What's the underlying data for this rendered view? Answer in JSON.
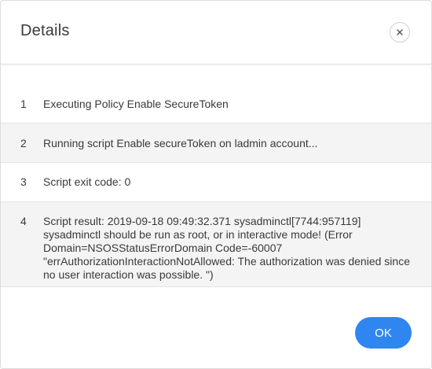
{
  "dialog": {
    "title": "Details",
    "close_icon": "close-icon",
    "ok_label": "OK",
    "accent_color": "#2f86f1"
  },
  "rows": [
    {
      "number": "1",
      "text": "Executing Policy Enable SecureToken"
    },
    {
      "number": "2",
      "text": "Running script Enable secureToken on ladmin account..."
    },
    {
      "number": "3",
      "text": "Script exit code: 0"
    },
    {
      "number": "4",
      "text": "Script result: 2019-09-18 09:49:32.371 sysadminctl[7744:957119] sysadminctl should be run as root, or in interactive mode! (Error Domain=NSOSStatusErrorDomain Code=-60007 \"errAuthorizationInteractionNotAllowed: The authorization was denied since no user interaction was possible. \")"
    }
  ]
}
